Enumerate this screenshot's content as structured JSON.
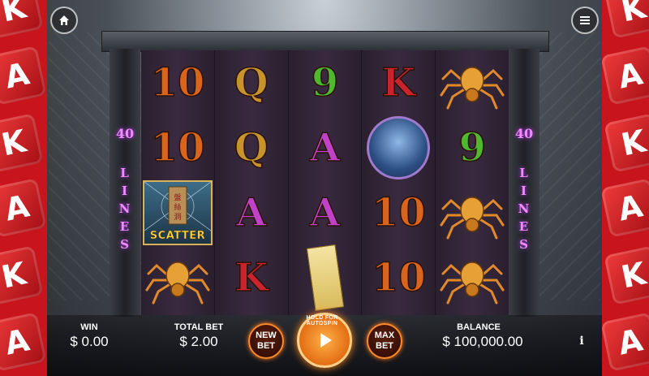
{
  "side_left": {
    "die_letters": [
      "K",
      "A",
      "K",
      "A",
      "K",
      "A"
    ]
  },
  "side_right": {
    "die_letters": [
      "K",
      "A",
      "K",
      "A",
      "K",
      "A"
    ]
  },
  "paylines": {
    "count": "40",
    "word_letters": [
      "L",
      "I",
      "N",
      "E",
      "S"
    ]
  },
  "reels": [
    {
      "symbols": [
        "10",
        "10",
        "SCATTER",
        "spider"
      ],
      "colors": [
        "orange",
        "orange",
        "",
        ""
      ]
    },
    {
      "symbols": [
        "Q",
        "Q",
        "A",
        "K"
      ],
      "colors": [
        "gold",
        "gold",
        "purple",
        "red"
      ]
    },
    {
      "symbols": [
        "9",
        "A",
        "A",
        "talisman"
      ],
      "colors": [
        "green",
        "purple",
        "purple",
        ""
      ]
    },
    {
      "symbols": [
        "K",
        "witch",
        "10",
        "10"
      ],
      "colors": [
        "red",
        "",
        "orange",
        "orange"
      ]
    },
    {
      "symbols": [
        "spider",
        "9",
        "spider",
        "spider"
      ],
      "colors": [
        "",
        "green",
        "",
        ""
      ]
    }
  ],
  "scatter_label": "SCATTER",
  "bottom_bar": {
    "win_label": "WIN",
    "win_value": "$ 0.00",
    "total_bet_label": "TOTAL BET",
    "total_bet_value": "$ 2.00",
    "new_bet_label": "NEW BET",
    "spin_caption": "HOLD FOR AUTOSPIN",
    "max_bet_label": "MAX BET",
    "balance_label": "BALANCE",
    "balance_value": "$ 100,000.00",
    "info_label": "i"
  },
  "icons": {
    "home": "home-icon",
    "menu": "menu-icon",
    "play": "play-icon"
  },
  "colors": {
    "accent_orange": "#ff8a2b",
    "lines_purple": "#f08cff",
    "dice_red": "#c8141c"
  }
}
